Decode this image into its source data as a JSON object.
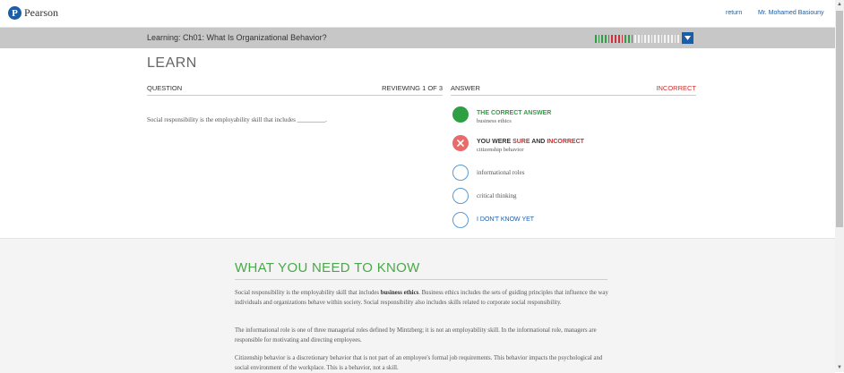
{
  "topbar": {
    "logo_mark": "P",
    "logo_text": "Pearson",
    "return_label": "return",
    "user_name": "Mr. Mohamed Basiouny"
  },
  "header": {
    "title": "Learning: Ch01: What Is Organizational Behavior?",
    "progress_segments": [
      "g",
      "g",
      "g",
      "g",
      "g",
      "r",
      "r",
      "r",
      "r",
      "g",
      "g",
      "g",
      "w",
      "w",
      "w",
      "w",
      "w",
      "w",
      "w",
      "w",
      "w",
      "w",
      "w",
      "w",
      "w",
      "w"
    ],
    "colors": {
      "correct": "#2ea043",
      "incorrect": "#d0303a",
      "pending": "#f2f2f2",
      "accent": "#1a5ea8"
    }
  },
  "learn": {
    "title": "LEARN",
    "question_label": "QUESTION",
    "reviewing": "REVIEWING 1 OF 3",
    "question_text": "Social responsibility is the employability skill that includes _________.",
    "answer_label": "ANSWER",
    "result": "INCORRECT"
  },
  "options": {
    "correct": {
      "status": "THE CORRECT ANSWER",
      "text": "business ethics"
    },
    "selected": {
      "prefix": "YOU WERE ",
      "sure": "SURE",
      "and": " AND ",
      "incorrect": "INCORRECT",
      "text": "citizenship behavior"
    },
    "other1": "informational roles",
    "other2": "critical thinking",
    "dont_know": "I DON'T KNOW YET"
  },
  "wyntk": {
    "title": "WHAT YOU NEED TO KNOW",
    "p1_before": "Social responsibility is the employability skill that includes ",
    "p1_bold": "business ethics",
    "p1_after": ". Business ethics includes the sets of guiding principles that influence the way individuals and organizations behave within society. Social responsibility also includes skills related to corporate social responsibility.",
    "p2": "The informational role is one of three managerial roles defined by Mintzberg; it is not an employability skill. In the informational role, managers are responsible for motivating and directing employees.",
    "p3": "Citizenship behavior is a discretionary behavior that is not part of an employee's formal job requirements. This behavior impacts the psychological and social environment of the workplace. This is a behavior, not a skill."
  },
  "scrollbar": {
    "up": "▲",
    "down": "▼"
  }
}
